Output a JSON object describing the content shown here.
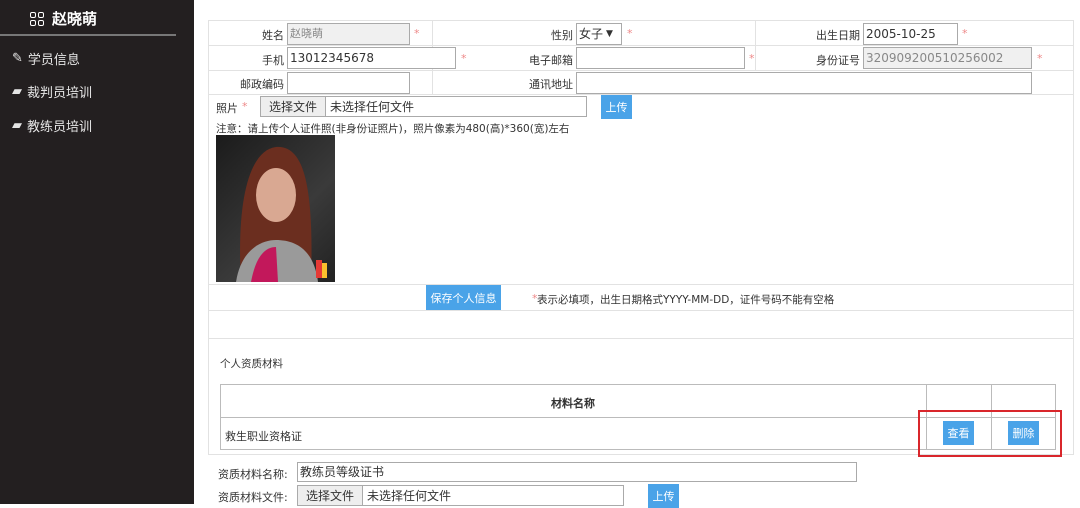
{
  "sidebar": {
    "user_name": "赵晓萌",
    "items": [
      {
        "label": "学员信息",
        "icon": "edit-icon"
      },
      {
        "label": "裁判员培训",
        "icon": "book-icon"
      },
      {
        "label": "教练员培训",
        "icon": "book-icon"
      }
    ]
  },
  "form": {
    "name_label": "姓名",
    "name_value": "赵晓萌",
    "gender_label": "性别",
    "gender_value": "女子",
    "birth_label": "出生日期",
    "birth_value": "2005-10-25",
    "phone_label": "手机",
    "phone_value": "13012345678",
    "email_label": "电子邮箱",
    "email_value": "",
    "id_label": "身份证号",
    "id_value": "320909200510256002",
    "postal_label": "邮政编码",
    "postal_value": "",
    "address_label": "通讯地址",
    "address_value": "",
    "required_mark": "*",
    "photo_label": "照片",
    "choose_file": "选择文件",
    "no_file": "未选择任何文件",
    "upload": "上传",
    "photo_note": "注意：请上传个人证件照(非身份证照片)，照片像素为480(高)*360(宽)左右",
    "save_button": "保存个人信息",
    "save_note": "表示必填项，出生日期格式YYYY-MM-DD，证件号码不能有空格"
  },
  "materials": {
    "section_title": "个人资质材料",
    "col_name": "材料名称",
    "rows": [
      {
        "name": "救生职业资格证",
        "view": "查看",
        "delete": "删除"
      }
    ]
  },
  "upload_material": {
    "name_label": "资质材料名称:",
    "name_value": "教练员等级证书",
    "file_label": "资质材料文件:",
    "choose_file": "选择文件",
    "no_file": "未选择任何文件",
    "upload": "上传"
  }
}
